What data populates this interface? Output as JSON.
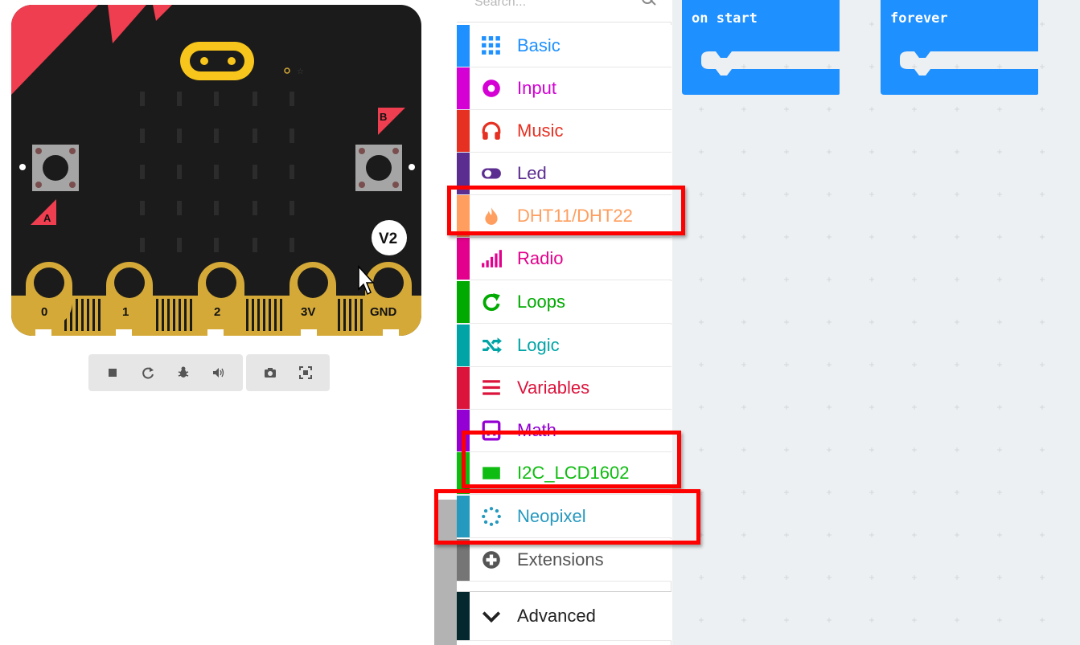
{
  "simulator": {
    "pins": [
      "0",
      "1",
      "2",
      "3V",
      "GND"
    ],
    "button_a": "A",
    "button_b": "B",
    "version_badge": "V2",
    "toolbar_icons": [
      "stop-icon",
      "restart-icon",
      "debug-icon",
      "mute-icon",
      "screenshot-icon",
      "fullscreen-icon"
    ]
  },
  "toolbox": {
    "search_placeholder": "Search...",
    "categories": [
      {
        "label": "Basic",
        "color": "#1e90ff",
        "icon": "grid-icon"
      },
      {
        "label": "Input",
        "color": "#d400d4",
        "icon": "input-circle-icon"
      },
      {
        "label": "Music",
        "color": "#e63022",
        "icon": "headphones-icon"
      },
      {
        "label": "Led",
        "color": "#5c2d91",
        "icon": "toggle-icon"
      },
      {
        "label": "DHT11/DHT22",
        "color": "#ff9e5e",
        "icon": "flame-icon"
      },
      {
        "label": "Radio",
        "color": "#e3008c",
        "icon": "signal-icon"
      },
      {
        "label": "Loops",
        "color": "#00aa00",
        "icon": "loop-icon"
      },
      {
        "label": "Logic",
        "color": "#00a4a6",
        "icon": "shuffle-icon"
      },
      {
        "label": "Variables",
        "color": "#dc143c",
        "icon": "list-icon"
      },
      {
        "label": "Math",
        "color": "#9400d3",
        "icon": "calculator-icon"
      },
      {
        "label": "I2C_LCD1602",
        "color": "#0fbc11",
        "icon": "lcd-icon"
      },
      {
        "label": "Neopixel",
        "color": "#2699bf",
        "icon": "neopixel-icon"
      },
      {
        "label": "Extensions",
        "color": "#757575",
        "icon": "plus-circle-icon"
      },
      {
        "label": "Advanced",
        "color": "#000000",
        "icon": "chevron-down-icon"
      }
    ]
  },
  "workspace": {
    "blocks": [
      {
        "label": "on start",
        "color": "#1e90ff"
      },
      {
        "label": "forever",
        "color": "#1e90ff"
      }
    ]
  }
}
